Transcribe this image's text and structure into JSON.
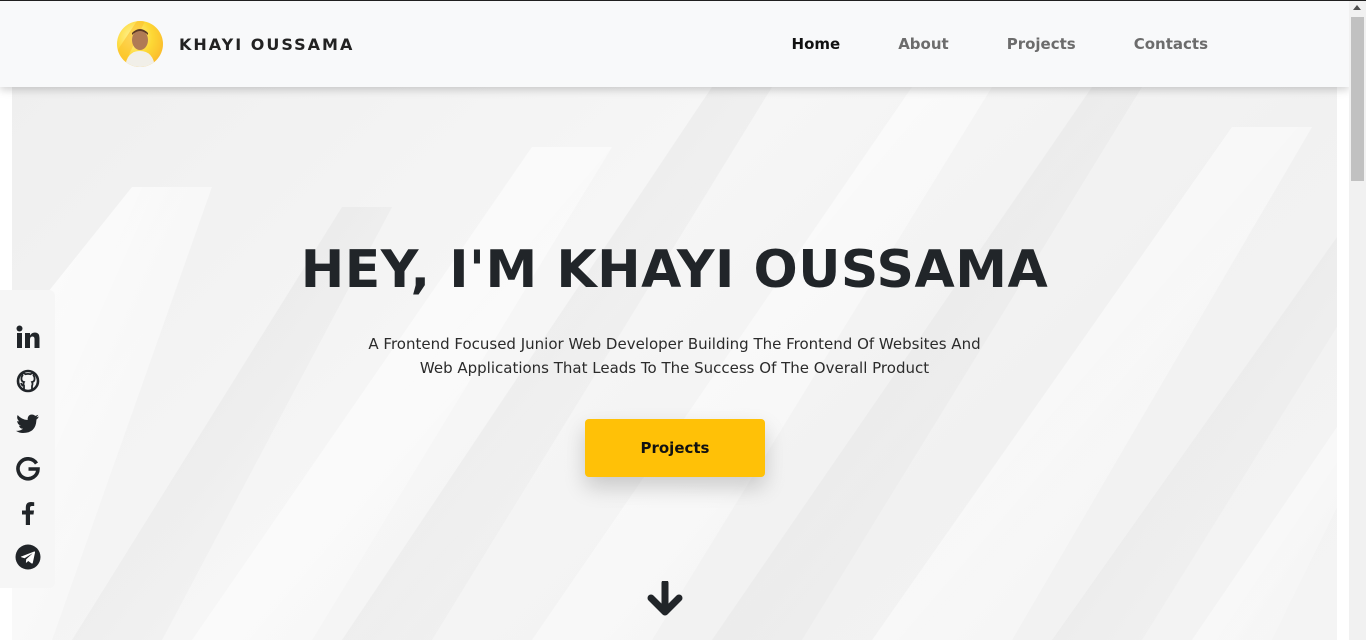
{
  "header": {
    "brand_name": "KHAYI OUSSAMA",
    "nav": [
      {
        "label": "Home",
        "active": true
      },
      {
        "label": "About",
        "active": false
      },
      {
        "label": "Projects",
        "active": false
      },
      {
        "label": "Contacts",
        "active": false
      }
    ]
  },
  "hero": {
    "title": "HEY, I'M KHAYI OUSSAMA",
    "subtitle": "A Frontend Focused Junior Web Developer Building The Frontend Of Websites And Web Applications That Leads To The Success Of The Overall Product",
    "cta_label": "Projects"
  },
  "social": [
    "linkedin-icon",
    "github-icon",
    "twitter-icon",
    "google-icon",
    "facebook-icon",
    "telegram-icon"
  ],
  "colors": {
    "accent": "#ffc107",
    "text": "#212529",
    "nav_inactive": "#6c6c6c",
    "header_bg": "#f8f9fa"
  }
}
